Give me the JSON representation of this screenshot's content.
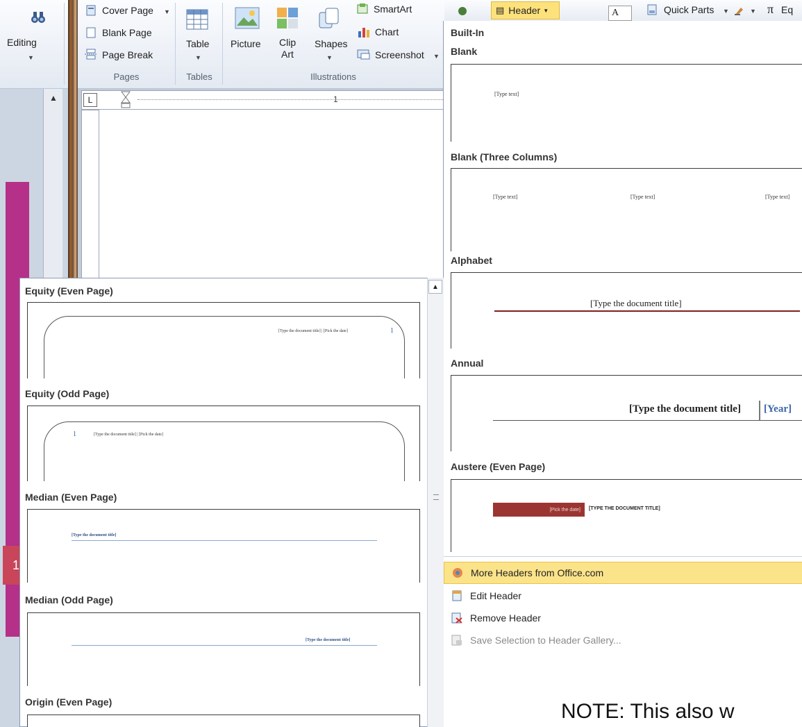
{
  "ribbon": {
    "editing": {
      "label": "Editing",
      "icon": "binoculars-icon"
    },
    "pages": {
      "group_label": "Pages",
      "items": [
        {
          "label": "Cover Page",
          "icon": "cover-page-icon"
        },
        {
          "label": "Blank Page",
          "icon": "blank-page-icon"
        },
        {
          "label": "Page Break",
          "icon": "page-break-icon"
        }
      ]
    },
    "tables": {
      "group_label": "Tables",
      "table_label": "Table"
    },
    "illustrations": {
      "group_label": "Illustrations",
      "picture_label": "Picture",
      "clip_art_line1": "Clip",
      "clip_art_line2": "Art",
      "shapes_label": "Shapes",
      "smartart_label": "SmartArt",
      "chart_label": "Chart",
      "screenshot_label": "Screenshot"
    }
  },
  "top_right": {
    "header_button": "Header",
    "textbox_glyph": "A",
    "quick_parts": "Quick Parts",
    "equation_symbol": "π",
    "equation_label": "Eq"
  },
  "ruler": {
    "mark": "1"
  },
  "sidebar": {
    "page_number": "1"
  },
  "header_gallery": {
    "section_title": "Built-In",
    "items": [
      {
        "title": "Blank",
        "placeholders": [
          "[Type text]"
        ]
      },
      {
        "title": "Blank (Three Columns)",
        "placeholders": [
          "[Type text]",
          "[Type text]",
          "[Type text]"
        ]
      },
      {
        "title": "Alphabet",
        "placeholders": [
          "[Type the document title]"
        ]
      },
      {
        "title": "Annual",
        "placeholders": [
          "[Type the document title]",
          "[Year]"
        ]
      },
      {
        "title": "Austere (Even Page)",
        "placeholders": [
          "[Pick the date]",
          "[TYPE THE DOCUMENT TITLE]"
        ]
      }
    ],
    "menu": [
      {
        "label": "More Headers from Office.com",
        "highlighted": true,
        "enabled": true,
        "icon": "office-globe-icon"
      },
      {
        "label": "Edit Header",
        "highlighted": false,
        "enabled": true,
        "icon": "edit-header-icon"
      },
      {
        "label": "Remove Header",
        "highlighted": false,
        "enabled": true,
        "icon": "remove-header-icon"
      },
      {
        "label": "Save Selection to Header Gallery...",
        "highlighted": false,
        "enabled": false,
        "icon": "save-gallery-icon"
      }
    ]
  },
  "footer_gallery": {
    "items": [
      {
        "title": "Equity (Even Page)",
        "text": "[Type the document title] | [Pick the date]",
        "num": "1"
      },
      {
        "title": "Equity (Odd Page)",
        "text": "[Type the document title] | [Pick the date]",
        "num": "1"
      },
      {
        "title": "Median (Even Page)",
        "text": "[Type the document title]"
      },
      {
        "title": "Median (Odd Page)",
        "text": "[Type the document title]"
      },
      {
        "title": "Origin (Even Page)"
      }
    ]
  },
  "note": "NOTE: This also w",
  "colors": {
    "highlight": "#fbe38a",
    "header_button_bg": "#fde27c",
    "magenta": "#b53088",
    "austere_red": "#9b3531",
    "annual_year_blue": "#3a64a8",
    "median_line": "#88a8cf"
  }
}
